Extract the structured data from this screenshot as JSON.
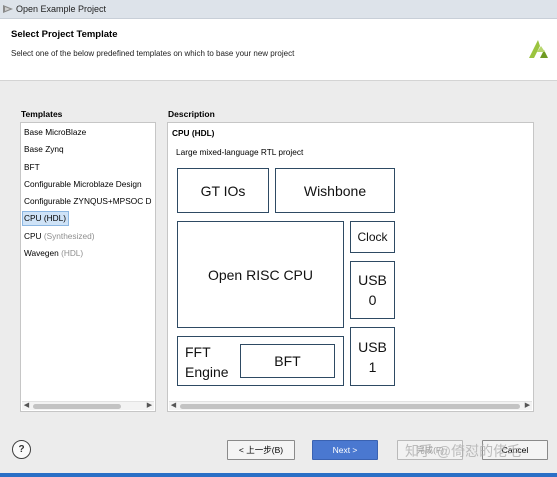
{
  "window": {
    "title": "Open Example Project"
  },
  "header": {
    "title": "Select Project Template",
    "subtitle": "Select one of the below predefined templates on which to base your new project",
    "logo_icon": "xilinx-logo",
    "accent_color": "#8db83e"
  },
  "templates": {
    "label": "Templates",
    "items": [
      {
        "name": "Base MicroBlaze",
        "tag": ""
      },
      {
        "name": "Base Zynq",
        "tag": ""
      },
      {
        "name": "BFT",
        "tag": ""
      },
      {
        "name": "Configurable Microblaze Design",
        "tag": ""
      },
      {
        "name": "Configurable ZYNQUS+MPSOC D",
        "tag": ""
      },
      {
        "name": "CPU ",
        "tag": "(HDL)"
      },
      {
        "name": "CPU ",
        "tag": "(Synthesized)"
      },
      {
        "name": "Wavegen ",
        "tag": "(HDL)"
      }
    ],
    "selected_index": 5
  },
  "description": {
    "label": "Description",
    "title": "CPU (HDL)",
    "text": "Large mixed-language RTL project",
    "blocks": {
      "gt_ios": "GT IOs",
      "wishbone": "Wishbone",
      "clock": "Clock",
      "open_risc_cpu": "Open RISC CPU",
      "usb0": "USB\n0",
      "usb1": "USB\n1",
      "fft_engine": "FFT\nEngine",
      "bft": "BFT"
    }
  },
  "buttons": {
    "help": "?",
    "back": "< 上一步(B)",
    "next": "Next >",
    "finish": "完成(F)",
    "cancel": "Cancel"
  },
  "watermark": "知乎 @倚怼的佬毛",
  "colors": {
    "primary_button": "#4a78d0",
    "selection": "#cfe3f7",
    "block_border": "#2e4a63"
  }
}
